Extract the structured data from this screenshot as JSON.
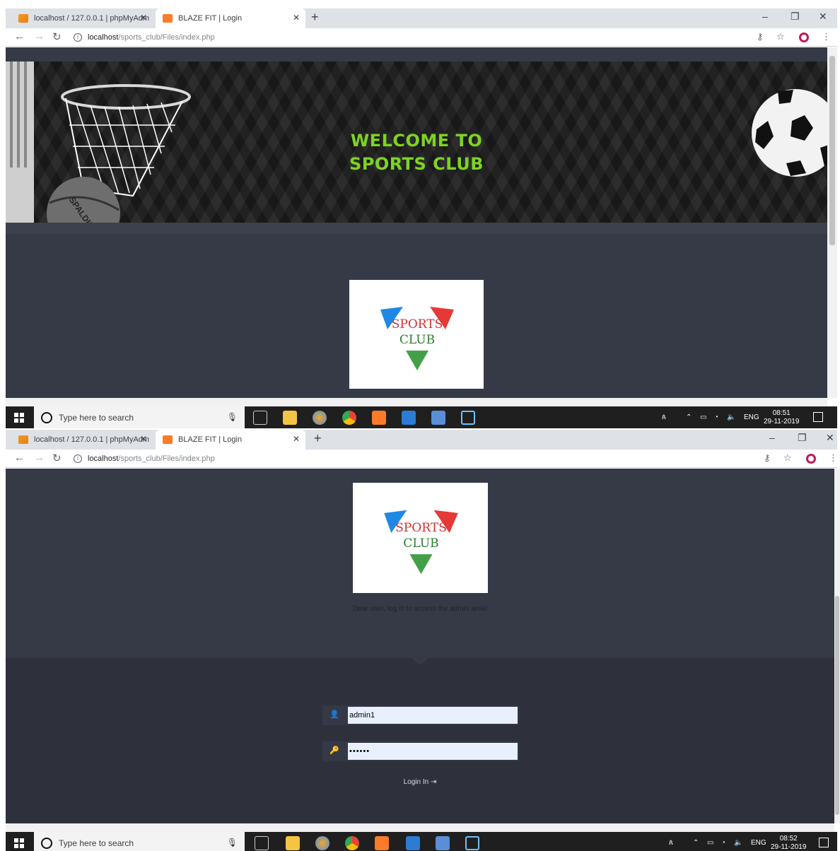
{
  "browser": {
    "tabs": [
      {
        "label": "localhost / 127.0.0.1 | phpMyAdm",
        "active": false
      },
      {
        "label": "BLAZE FIT | Login",
        "active": true
      }
    ],
    "new_tab": "+",
    "close_glyph": "✕",
    "url_host": "localhost",
    "url_path": "/sports_club/Files/index.php",
    "window_controls": {
      "minimize": "–",
      "restore": "❐",
      "close": "✕"
    }
  },
  "page": {
    "banner_line1": "WELCOME TO",
    "banner_line2": "SPORTS CLUB",
    "logo_line1": "SPORTS",
    "logo_line2": "CLUB",
    "basketball_brand": "SPALDING",
    "lead_text": "Dear user, log in to access the admin area!",
    "username_value": "admin1",
    "password_value": "••••••",
    "login_label": "Login In ⇥"
  },
  "taskbar": {
    "search_placeholder": "Type here to search",
    "language": "ENG",
    "shot1_time": "08:51",
    "shot1_date": "29-11-2019",
    "shot2_time": "08:52",
    "shot2_date": "29-11-2019"
  },
  "colors": {
    "banner_text": "#7ed321",
    "page_bg": "#363a47",
    "form_bg": "#2e313c",
    "logo_red": "#e53935",
    "logo_blue": "#1e88e5",
    "logo_green": "#43a047"
  }
}
